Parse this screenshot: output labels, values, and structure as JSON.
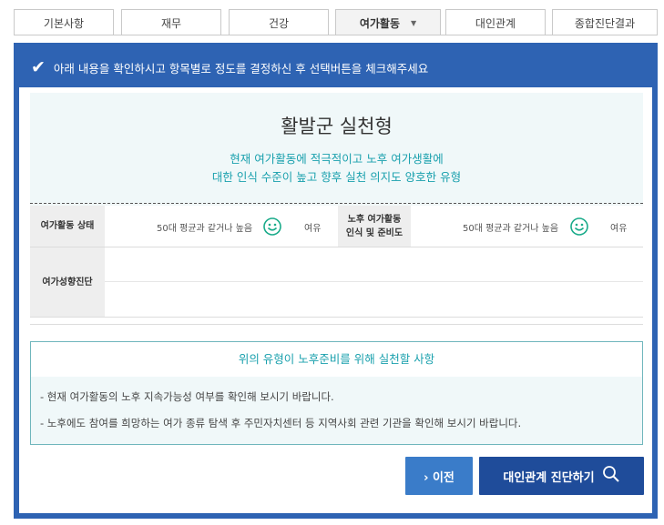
{
  "tabs": [
    {
      "label": "기본사항",
      "active": false
    },
    {
      "label": "재무",
      "active": false
    },
    {
      "label": "건강",
      "active": false
    },
    {
      "label": "여가활동",
      "active": true
    },
    {
      "label": "대인관계",
      "active": false
    },
    {
      "label": "종합진단결과",
      "active": false
    }
  ],
  "active_tab_caret": "▼",
  "instruction": {
    "check": "✔",
    "text": "아래 내용을 확인하시고 항목별로 정도를 결정하신 후 선택버튼을 체크해주세요"
  },
  "result": {
    "title": "활발군 실천형",
    "desc_line1": "현재 여가활동에 적극적이고 노후 여가생활에",
    "desc_line2": "대한 인식 수준이 높고 향후 실천 의지도 양호한 유형"
  },
  "table": {
    "row1": {
      "label": "여가활동 상태",
      "value": "50대 평균과 같거나 높음",
      "status": "여유",
      "label2_line1": "노후 여가활동",
      "label2_line2": "인식 및 준비도",
      "value2": "50대 평균과 같거나 높음",
      "status2": "여유"
    },
    "row2": {
      "label": "여가성향진단"
    }
  },
  "actions": {
    "title": "위의 유형이 노후준비를 위해 실천할 사항",
    "items": [
      "- 현재 여가활동의 노후 지속가능성 여부를 확인해 보시기 바랍니다.",
      "- 노후에도 참여를 희망하는 여가 종류 탐색 후 주민자치센터 등 지역사회 관련 기관을 확인해 보시기 바랍니다."
    ]
  },
  "buttons": {
    "prev": "› 이전",
    "next": "대인관계 진단하기"
  },
  "colors": {
    "frame_blue": "#2e63b3",
    "teal_text": "#19a0ad",
    "smiley": "#1aab8a",
    "btn_prev": "#3a7cc9",
    "btn_next": "#1f4c9a"
  }
}
